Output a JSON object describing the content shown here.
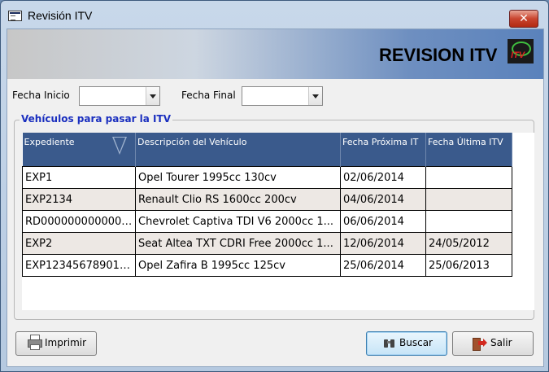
{
  "window": {
    "title": "Revisión ITV",
    "close_glyph": "✕"
  },
  "banner": {
    "title": "REVISION ITV",
    "logo_text": "ITV"
  },
  "filters": {
    "start_label": "Fecha Inicio",
    "start_value": "",
    "end_label": "Fecha Final",
    "end_value": ""
  },
  "group": {
    "title": "Vehículos para pasar la ITV"
  },
  "table": {
    "columns": [
      "Expediente",
      "Descripción del Vehículo",
      "Fecha Próxima IT",
      "Fecha Última ITV"
    ],
    "rows": [
      [
        "EXP1",
        "Opel Tourer  1995cc 130cv",
        "02/06/2014",
        ""
      ],
      [
        "EXP2134",
        "Renault Clio RS 1600cc 200cv",
        "04/06/2014",
        ""
      ],
      [
        "RD0000000000000...",
        "Chevrolet Captiva TDI V6 2000cc 1...",
        "06/06/2014",
        ""
      ],
      [
        "EXP2",
        "Seat Altea TXT CDRI Free 2000cc 1...",
        "12/06/2014",
        "24/05/2012"
      ],
      [
        "EXP123456789012...",
        "Opel Zafira B 1995cc 125cv",
        "25/06/2014",
        "25/06/2013"
      ]
    ]
  },
  "buttons": {
    "print": "Imprimir",
    "search": "Buscar",
    "exit": "Salir"
  },
  "icons": {
    "app": "window-app-icon",
    "close": "close-icon",
    "logo": "itv-logo-icon",
    "sort": "sort-desc-icon",
    "print": "printer-icon",
    "search": "binoculars-icon",
    "exit": "exit-door-icon"
  },
  "colors": {
    "header_bg": "#3a5a8c",
    "row_alt_bg": "#ede8e4",
    "group_title": "#1a2fbf",
    "close_red": "#c9452f"
  }
}
